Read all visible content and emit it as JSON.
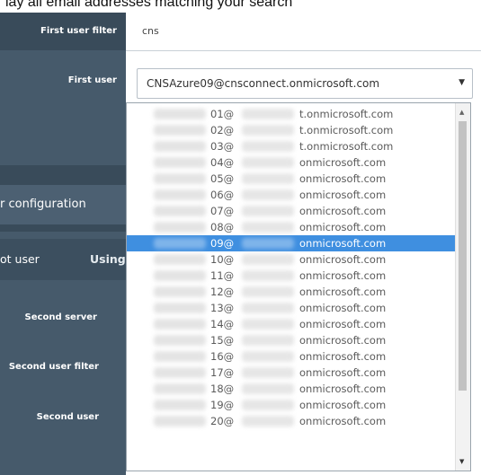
{
  "caption": "lay all email addresses matching your search",
  "sidebar": {
    "first_user_filter_label": "First user filter",
    "first_user_label": "First user",
    "config_tab": "r configuration",
    "root_user_tab": "ot user",
    "using_tab": "Using",
    "second_server_label": "Second server",
    "second_user_filter_label": "Second user filter",
    "second_user_label": "Second user"
  },
  "filter": {
    "value": "cns"
  },
  "select": {
    "value": "CNSAzure09@cnsconnect.onmicrosoft.com"
  },
  "dropdown": {
    "selected_index": 8,
    "options": [
      {
        "num": "01@",
        "domain": "t.onmicrosoft.com"
      },
      {
        "num": "02@",
        "domain": "t.onmicrosoft.com"
      },
      {
        "num": "03@",
        "domain": "t.onmicrosoft.com"
      },
      {
        "num": "04@",
        "domain": "onmicrosoft.com"
      },
      {
        "num": "05@",
        "domain": "onmicrosoft.com"
      },
      {
        "num": "06@",
        "domain": "onmicrosoft.com"
      },
      {
        "num": "07@",
        "domain": "onmicrosoft.com"
      },
      {
        "num": "08@",
        "domain": "onmicrosoft.com"
      },
      {
        "num": "09@",
        "domain": "onmicrosoft.com"
      },
      {
        "num": "10@",
        "domain": "onmicrosoft.com"
      },
      {
        "num": "11@",
        "domain": "onmicrosoft.com"
      },
      {
        "num": "12@",
        "domain": "onmicrosoft.com"
      },
      {
        "num": "13@",
        "domain": "onmicrosoft.com"
      },
      {
        "num": "14@",
        "domain": "onmicrosoft.com"
      },
      {
        "num": "15@",
        "domain": "onmicrosoft.com"
      },
      {
        "num": "16@",
        "domain": "onmicrosoft.com"
      },
      {
        "num": "17@",
        "domain": "onmicrosoft.com"
      },
      {
        "num": "18@",
        "domain": "onmicrosoft.com"
      },
      {
        "num": "19@",
        "domain": "onmicrosoft.com"
      },
      {
        "num": "20@",
        "domain": "onmicrosoft.com"
      }
    ]
  },
  "colors": {
    "sidebar": "#465a6b",
    "sidebar_dark": "#394b5a",
    "selection": "#3f8fe0"
  }
}
